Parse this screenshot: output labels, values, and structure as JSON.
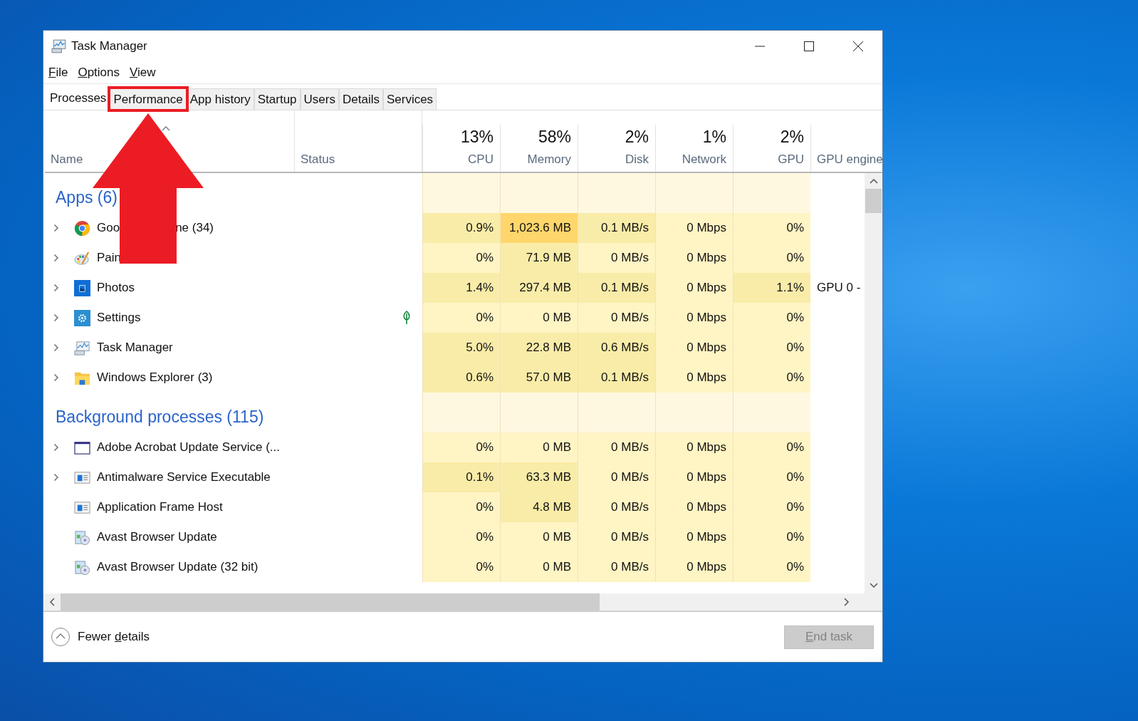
{
  "window": {
    "title": "Task Manager"
  },
  "menu": [
    {
      "label": "File"
    },
    {
      "label": "Options"
    },
    {
      "label": "View"
    }
  ],
  "tabs": [
    {
      "label": "Processes",
      "selected": true,
      "highlighted": false
    },
    {
      "label": "Performance",
      "selected": false,
      "highlighted": true
    },
    {
      "label": "App history",
      "selected": false,
      "highlighted": false
    },
    {
      "label": "Startup",
      "selected": false,
      "highlighted": false
    },
    {
      "label": "Users",
      "selected": false,
      "highlighted": false
    },
    {
      "label": "Details",
      "selected": false,
      "highlighted": false
    },
    {
      "label": "Services",
      "selected": false,
      "highlighted": false
    }
  ],
  "annotation_arrow": true,
  "columns": {
    "name": {
      "label": "Name",
      "sorted": true
    },
    "status": {
      "label": "Status"
    },
    "metrics": [
      {
        "total": "13%",
        "label": "CPU"
      },
      {
        "total": "58%",
        "label": "Memory"
      },
      {
        "total": "2%",
        "label": "Disk"
      },
      {
        "total": "1%",
        "label": "Network"
      },
      {
        "total": "2%",
        "label": "GPU"
      }
    ],
    "engine": {
      "label": "GPU engine"
    }
  },
  "groups": [
    {
      "title": "Apps (6)",
      "rows": [
        {
          "name": "Goo",
          "name_tail": "ne (34)",
          "kind": "chrome",
          "expandable": true,
          "efficiency_mode": false,
          "cells": [
            {
              "text": "0.9%",
              "shaded": true,
              "hot": false
            },
            {
              "text": "1,023.6 MB",
              "shaded": true,
              "hot": true
            },
            {
              "text": "0.1 MB/s",
              "shaded": true,
              "hot": false
            },
            {
              "text": "0 Mbps",
              "shaded": false,
              "hot": false
            },
            {
              "text": "0%",
              "shaded": false,
              "hot": false
            }
          ]
        },
        {
          "name": "Pain",
          "kind": "paint",
          "expandable": true,
          "efficiency_mode": false,
          "cells": [
            {
              "text": "0%",
              "shaded": false,
              "hot": false
            },
            {
              "text": "71.9 MB",
              "shaded": true,
              "hot": false
            },
            {
              "text": "0 MB/s",
              "shaded": false,
              "hot": false
            },
            {
              "text": "0 Mbps",
              "shaded": false,
              "hot": false
            },
            {
              "text": "0%",
              "shaded": false,
              "hot": false
            }
          ]
        },
        {
          "name": "Photos",
          "kind": "photos",
          "expandable": true,
          "efficiency_mode": false,
          "engine": "GPU 0 -",
          "cells": [
            {
              "text": "1.4%",
              "shaded": true,
              "hot": false
            },
            {
              "text": "297.4 MB",
              "shaded": true,
              "hot": false
            },
            {
              "text": "0.1 MB/s",
              "shaded": true,
              "hot": false
            },
            {
              "text": "0 Mbps",
              "shaded": false,
              "hot": false
            },
            {
              "text": "1.1%",
              "shaded": true,
              "hot": false
            }
          ]
        },
        {
          "name": "Settings",
          "kind": "settings",
          "expandable": true,
          "efficiency_mode": true,
          "cells": [
            {
              "text": "0%",
              "shaded": false,
              "hot": false
            },
            {
              "text": "0 MB",
              "shaded": false,
              "hot": false
            },
            {
              "text": "0 MB/s",
              "shaded": false,
              "hot": false
            },
            {
              "text": "0 Mbps",
              "shaded": false,
              "hot": false
            },
            {
              "text": "0%",
              "shaded": false,
              "hot": false
            }
          ]
        },
        {
          "name": "Task Manager",
          "kind": "taskmgr",
          "expandable": true,
          "efficiency_mode": false,
          "cells": [
            {
              "text": "5.0%",
              "shaded": true,
              "hot": false
            },
            {
              "text": "22.8 MB",
              "shaded": true,
              "hot": false
            },
            {
              "text": "0.6 MB/s",
              "shaded": true,
              "hot": false
            },
            {
              "text": "0 Mbps",
              "shaded": false,
              "hot": false
            },
            {
              "text": "0%",
              "shaded": false,
              "hot": false
            }
          ]
        },
        {
          "name": "Windows Explorer (3)",
          "kind": "explorer",
          "expandable": true,
          "efficiency_mode": false,
          "cells": [
            {
              "text": "0.6%",
              "shaded": true,
              "hot": false
            },
            {
              "text": "57.0 MB",
              "shaded": true,
              "hot": false
            },
            {
              "text": "0.1 MB/s",
              "shaded": true,
              "hot": false
            },
            {
              "text": "0 Mbps",
              "shaded": false,
              "hot": false
            },
            {
              "text": "0%",
              "shaded": false,
              "hot": false
            }
          ]
        }
      ]
    },
    {
      "title": "Background processes (115)",
      "rows": [
        {
          "name": "Adobe Acrobat Update Service (...",
          "kind": "window",
          "expandable": true,
          "efficiency_mode": false,
          "cells": [
            {
              "text": "0%",
              "shaded": false,
              "hot": false
            },
            {
              "text": "0 MB",
              "shaded": false,
              "hot": false
            },
            {
              "text": "0 MB/s",
              "shaded": false,
              "hot": false
            },
            {
              "text": "0 Mbps",
              "shaded": false,
              "hot": false
            },
            {
              "text": "0%",
              "shaded": false,
              "hot": false
            }
          ]
        },
        {
          "name": "Antimalware Service Executable",
          "kind": "appframe",
          "expandable": true,
          "efficiency_mode": false,
          "cells": [
            {
              "text": "0.1%",
              "shaded": true,
              "hot": false
            },
            {
              "text": "63.3 MB",
              "shaded": true,
              "hot": false
            },
            {
              "text": "0 MB/s",
              "shaded": false,
              "hot": false
            },
            {
              "text": "0 Mbps",
              "shaded": false,
              "hot": false
            },
            {
              "text": "0%",
              "shaded": false,
              "hot": false
            }
          ]
        },
        {
          "name": "Application Frame Host",
          "kind": "appframe",
          "expandable": false,
          "efficiency_mode": false,
          "cells": [
            {
              "text": "0%",
              "shaded": false,
              "hot": false
            },
            {
              "text": "4.8 MB",
              "shaded": true,
              "hot": false
            },
            {
              "text": "0 MB/s",
              "shaded": false,
              "hot": false
            },
            {
              "text": "0 Mbps",
              "shaded": false,
              "hot": false
            },
            {
              "text": "0%",
              "shaded": false,
              "hot": false
            }
          ]
        },
        {
          "name": "Avast Browser Update",
          "kind": "installer",
          "expandable": false,
          "efficiency_mode": false,
          "cells": [
            {
              "text": "0%",
              "shaded": false,
              "hot": false
            },
            {
              "text": "0 MB",
              "shaded": false,
              "hot": false
            },
            {
              "text": "0 MB/s",
              "shaded": false,
              "hot": false
            },
            {
              "text": "0 Mbps",
              "shaded": false,
              "hot": false
            },
            {
              "text": "0%",
              "shaded": false,
              "hot": false
            }
          ]
        },
        {
          "name": "Avast Browser Update (32 bit)",
          "kind": "installer",
          "expandable": false,
          "efficiency_mode": false,
          "cells": [
            {
              "text": "0%",
              "shaded": false,
              "hot": false
            },
            {
              "text": "0 MB",
              "shaded": false,
              "hot": false
            },
            {
              "text": "0 MB/s",
              "shaded": false,
              "hot": false
            },
            {
              "text": "0 Mbps",
              "shaded": false,
              "hot": false
            },
            {
              "text": "0%",
              "shaded": false,
              "hot": false
            }
          ]
        }
      ]
    }
  ],
  "footer": {
    "toggle": {
      "label": "Fewer details"
    },
    "end_task": {
      "label": "End task",
      "disabled": true
    }
  }
}
